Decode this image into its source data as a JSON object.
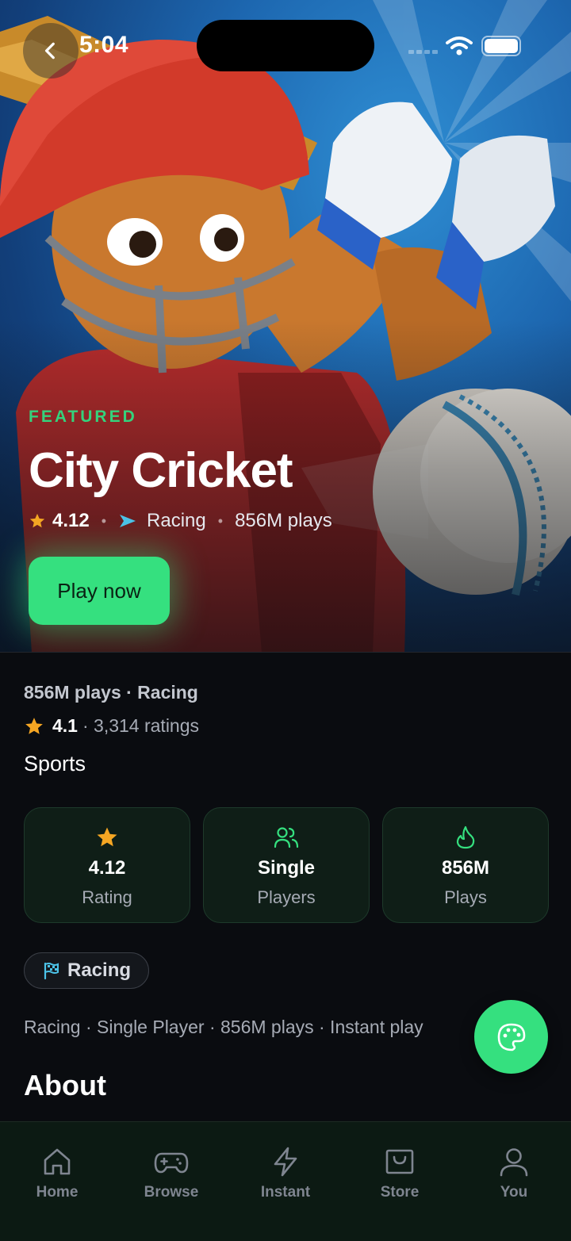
{
  "status_bar": {
    "time": "5:04"
  },
  "hero": {
    "eyebrow": "FEATURED",
    "title": "City Cricket",
    "rating": "4.12",
    "genre": "Racing",
    "plays": "856M plays",
    "play_button": "Play now"
  },
  "details": {
    "plays_genre": "856M plays · Racing",
    "rating_value": "4.1",
    "rating_count": "· 3,314 ratings",
    "category": "Sports"
  },
  "stats": [
    {
      "icon": "star-icon",
      "value": "4.12",
      "label": "Rating"
    },
    {
      "icon": "users-icon",
      "value": "Single",
      "label": "Players"
    },
    {
      "icon": "flame-icon",
      "value": "856M",
      "label": "Plays"
    }
  ],
  "genre_chip": {
    "icon": "flag-icon",
    "label": "Racing"
  },
  "tags_line": "Racing · Single Player · 856M plays · Instant play",
  "section_title": "About",
  "fab": {
    "icon": "palette-icon"
  },
  "nav": [
    {
      "icon": "home-icon",
      "label": "Home"
    },
    {
      "icon": "gamepad-icon",
      "label": "Browse"
    },
    {
      "icon": "lightning-icon",
      "label": "Instant"
    },
    {
      "icon": "store-icon",
      "label": "Store"
    },
    {
      "icon": "user-icon",
      "label": "You"
    }
  ],
  "colors": {
    "accent": "#35e07f",
    "featured_label": "#34d27c",
    "star": "#f5a623",
    "background": "#0a0c10",
    "card": "#0f1e17",
    "nav_bg": "#0c1a13"
  }
}
